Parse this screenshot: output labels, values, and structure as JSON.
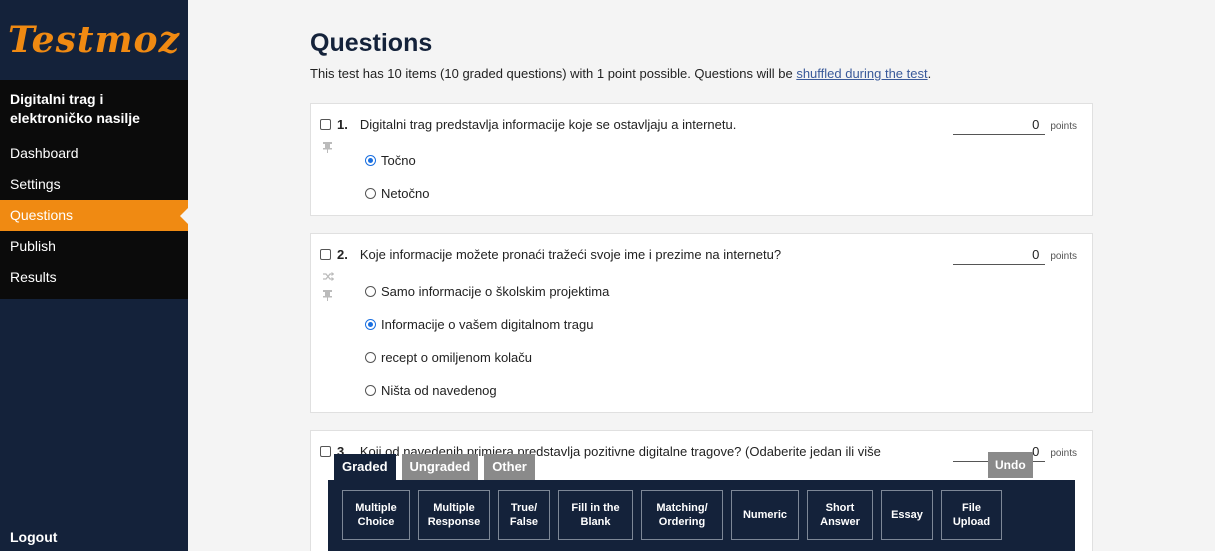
{
  "sidebar": {
    "brand": "Testmoz",
    "test_name": "Digitalni trag i elektroničko nasilje",
    "items": [
      {
        "label": "Dashboard",
        "active": false
      },
      {
        "label": "Settings",
        "active": false
      },
      {
        "label": "Questions",
        "active": true
      },
      {
        "label": "Publish",
        "active": false
      },
      {
        "label": "Results",
        "active": false
      }
    ],
    "logout": "Logout"
  },
  "main": {
    "title": "Questions",
    "summary_prefix": "This test has 10 items (10 graded questions) with 1 point possible. Questions will be ",
    "summary_link": "shuffled during the test",
    "summary_suffix": "."
  },
  "questions": [
    {
      "number": "1.",
      "text": "Digitalni trag predstavlja informacije koje se ostavljaju a internetu.",
      "points": "0",
      "points_label": "points",
      "icons": [
        "pin-icon"
      ],
      "answers": [
        {
          "label": "Točno",
          "selected": true
        },
        {
          "label": "Netočno",
          "selected": false
        }
      ]
    },
    {
      "number": "2.",
      "text": "Koje informacije možete pronaći tražeći svoje ime i prezime na internetu?",
      "points": "0",
      "points_label": "points",
      "icons": [
        "shuffle-icon",
        "pin-icon"
      ],
      "answers": [
        {
          "label": "Samo informacije o školskim projektima",
          "selected": false
        },
        {
          "label": "Informacije o vašem digitalnom tragu",
          "selected": true
        },
        {
          "label": "recept o omiljenom kolaču",
          "selected": false
        },
        {
          "label": "Ništa od navedenog",
          "selected": false
        }
      ]
    },
    {
      "number": "3.",
      "text": "Koji od navedenih primjera predstavlja pozitivne digitalne tragove? (Odaberite jedan ili više",
      "points": "0",
      "points_label": "points"
    }
  ],
  "toolbar": {
    "tabs": [
      {
        "label": "Graded",
        "active": true
      },
      {
        "label": "Ungraded",
        "active": false
      },
      {
        "label": "Other",
        "active": false
      }
    ],
    "undo": "Undo",
    "buttons": [
      {
        "label": "Multiple Choice"
      },
      {
        "label": "Multiple Response"
      },
      {
        "label": "True/ False"
      },
      {
        "label": "Fill in the Blank"
      },
      {
        "label": "Matching/ Ordering"
      },
      {
        "label": "Numeric"
      },
      {
        "label": "Short Answer"
      },
      {
        "label": "Essay"
      },
      {
        "label": "File Upload"
      }
    ]
  },
  "colors": {
    "accent": "#f08a12",
    "navy": "#14223a",
    "radio": "#1a6fe0"
  }
}
